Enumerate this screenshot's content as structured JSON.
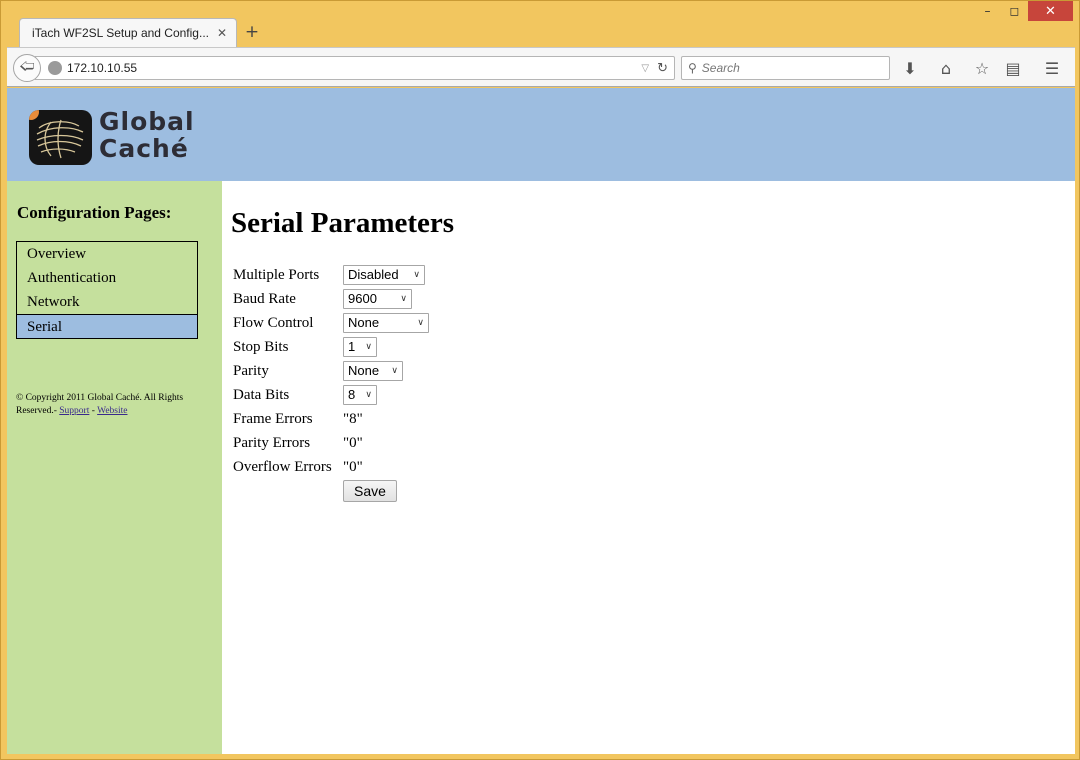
{
  "browser": {
    "tab_title": "iTach WF2SL Setup and Config...",
    "url": "172.10.10.55",
    "search_placeholder": "Search",
    "window_controls": [
      "minimize-icon",
      "maximize-icon",
      "close-icon"
    ]
  },
  "header": {
    "logo_line1": "Global",
    "logo_line2": "Caché"
  },
  "sidebar": {
    "title": "Configuration Pages:",
    "items": [
      {
        "label": "Overview",
        "active": false
      },
      {
        "label": "Authentication",
        "active": false
      },
      {
        "label": "Network",
        "active": false
      },
      {
        "label": "Serial",
        "active": true
      }
    ],
    "footer_text": "© Copyright 2011 Global Caché. All Rights Reserved.-",
    "footer_sep": "-",
    "support_link": "Support",
    "website_link": "Website"
  },
  "main": {
    "title": "Serial Parameters",
    "fields": {
      "multiple_ports": {
        "label": "Multiple Ports",
        "value": "Disabled"
      },
      "baud_rate": {
        "label": "Baud Rate",
        "value": "9600"
      },
      "flow_control": {
        "label": "Flow Control",
        "value": "None"
      },
      "stop_bits": {
        "label": "Stop Bits",
        "value": "1"
      },
      "parity": {
        "label": "Parity",
        "value": "None"
      },
      "data_bits": {
        "label": "Data Bits",
        "value": "8"
      },
      "frame_errors": {
        "label": "Frame Errors",
        "value": "\"8\""
      },
      "parity_errors": {
        "label": "Parity Errors",
        "value": "\"0\""
      },
      "overflow_errors": {
        "label": "Overflow Errors",
        "value": "\"0\""
      }
    },
    "save_label": "Save"
  },
  "colors": {
    "header_bg": "#9dbde0",
    "sidebar_bg": "#c5e09d",
    "window_frame": "#f2c65f"
  }
}
